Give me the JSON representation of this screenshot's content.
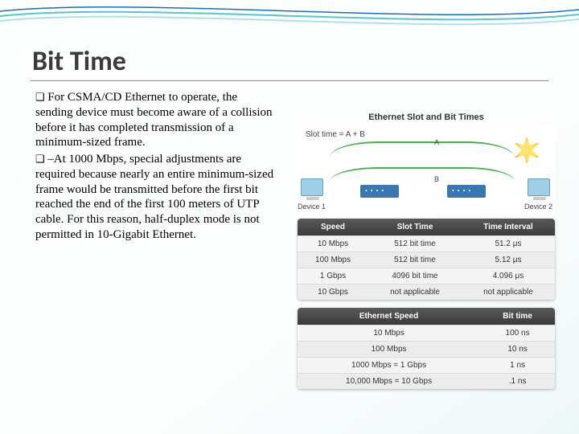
{
  "title": "Bit Time",
  "bullets": {
    "p1": "For CSMA/CD Ethernet to operate, the sending device must become aware of a collision before it has completed transmission of a minimum-sized frame.",
    "p2": "–At 1000 Mbps, special adjustments are required because nearly an entire minimum-sized frame would be transmitted before the first bit reached the end of the first 100 meters of UTP cable. For this reason, half-duplex mode is not permitted in 10-Gigabit Ethernet."
  },
  "figure": {
    "title": "Ethernet Slot and Bit Times",
    "slot_label": "Slot time = A + B",
    "label_a": "A",
    "label_b": "B",
    "device1": "Device 1",
    "device2": "Device 2"
  },
  "table1": {
    "headers": [
      "Speed",
      "Slot Time",
      "Time Interval"
    ],
    "rows": [
      [
        "10 Mbps",
        "512 bit time",
        "51.2 μs"
      ],
      [
        "100 Mbps",
        "512 bit time",
        "5.12 μs"
      ],
      [
        "1 Gbps",
        "4096 bit time",
        "4.096 μs"
      ],
      [
        "10 Gbps",
        "not applicable",
        "not applicable"
      ]
    ]
  },
  "table2": {
    "headers": [
      "Ethernet Speed",
      "Bit time"
    ],
    "rows": [
      [
        "10 Mbps",
        "100 ns"
      ],
      [
        "100 Mbps",
        "10 ns"
      ],
      [
        "1000 Mbps = 1 Gbps",
        "1 ns"
      ],
      [
        "10,000 Mbps = 10 Gbps",
        ".1 ns"
      ]
    ]
  }
}
